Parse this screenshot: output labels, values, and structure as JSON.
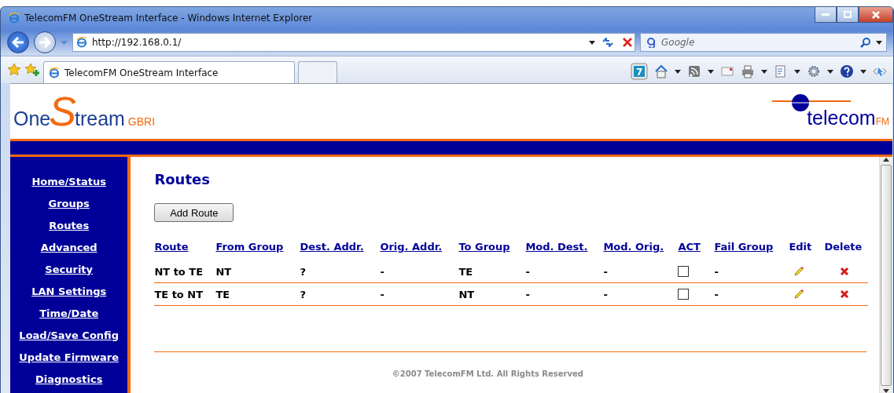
{
  "window": {
    "title": "TelecomFM OneStream Interface - Windows Internet Explorer"
  },
  "address_bar": {
    "value": "http://192.168.0.1/"
  },
  "search": {
    "placeholder": "Google"
  },
  "tabs": [
    {
      "label": "TelecomFM OneStream Interface",
      "selected": true
    },
    {
      "selected": false
    }
  ],
  "toolbar": {
    "badge": "7"
  },
  "product_logo": {
    "before": "One",
    "initial": "S",
    "after": "tream",
    "suffix": "GBRI"
  },
  "company_logo": {
    "name": "telecom",
    "suffix": "FM"
  },
  "sidebar": {
    "items": [
      {
        "label": "Home/Status"
      },
      {
        "label": "Groups"
      },
      {
        "label": "Routes"
      },
      {
        "label": "Advanced"
      },
      {
        "label": "Security"
      },
      {
        "label": "LAN Settings"
      },
      {
        "label": "Time/Date"
      },
      {
        "label": "Load/Save Config"
      },
      {
        "label": "Update Firmware"
      },
      {
        "label": "Diagnostics"
      }
    ]
  },
  "page": {
    "heading": "Routes",
    "add_button": "Add Route"
  },
  "table": {
    "columns": [
      {
        "label": "Route",
        "link": true
      },
      {
        "label": "From Group",
        "link": true
      },
      {
        "label": "Dest. Addr.",
        "link": true
      },
      {
        "label": "Orig. Addr.",
        "link": true
      },
      {
        "label": "To Group",
        "link": true
      },
      {
        "label": "Mod. Dest.",
        "link": true
      },
      {
        "label": "Mod. Orig.",
        "link": true
      },
      {
        "label": "ACT",
        "link": true
      },
      {
        "label": "Fail Group",
        "link": true
      },
      {
        "label": "Edit",
        "link": false
      },
      {
        "label": "Delete",
        "link": false
      }
    ],
    "rows": [
      {
        "route": "NT to TE",
        "from_group": "NT",
        "dest_addr": "?",
        "orig_addr": "-",
        "to_group": "TE",
        "mod_dest": "-",
        "mod_orig": "-",
        "act": false,
        "fail_group": "-"
      },
      {
        "route": "TE to NT",
        "from_group": "TE",
        "dest_addr": "?",
        "orig_addr": "-",
        "to_group": "NT",
        "mod_dest": "-",
        "mod_orig": "-",
        "act": false,
        "fail_group": "-"
      }
    ]
  },
  "footer": "©2007 TelecomFM Ltd. All Rights Reserved"
}
